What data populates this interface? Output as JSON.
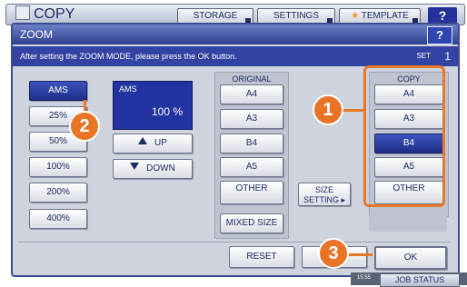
{
  "topbar": {
    "title": "COPY",
    "storage": "STORAGE",
    "settings": "SETTINGS",
    "template": "TEMPLATE",
    "help": "?"
  },
  "dialog": {
    "title": "ZOOM",
    "help": "?",
    "instruction": "After setting the ZOOM MODE, please press the OK button.",
    "set_label": "SET",
    "set_count": "1"
  },
  "zoom": {
    "ams": "AMS",
    "presets": [
      "25%",
      "50%",
      "100%",
      "200%",
      "400%"
    ],
    "display_label": "AMS",
    "display_value": "100 %",
    "up": "UP",
    "down": "DOWN"
  },
  "original": {
    "heading": "ORIGINAL",
    "sizes": [
      "A4",
      "A3",
      "B4",
      "A5",
      "OTHER",
      "MIXED SIZE"
    ]
  },
  "size_setting": "SIZE SETTING",
  "copy": {
    "heading": "COPY",
    "sizes": [
      "A4",
      "A3",
      "B4",
      "A5",
      "OTHER"
    ],
    "selected": "B4"
  },
  "footer": {
    "reset": "RESET",
    "cancel": "C",
    "ok": "OK"
  },
  "callouts": [
    "1",
    "2",
    "3"
  ],
  "status": {
    "job_status": "JOB STATUS",
    "time": "15:55"
  },
  "colors": {
    "accent": "#2233a2",
    "callout": "#ea7426",
    "selected": "#1e2e86"
  }
}
